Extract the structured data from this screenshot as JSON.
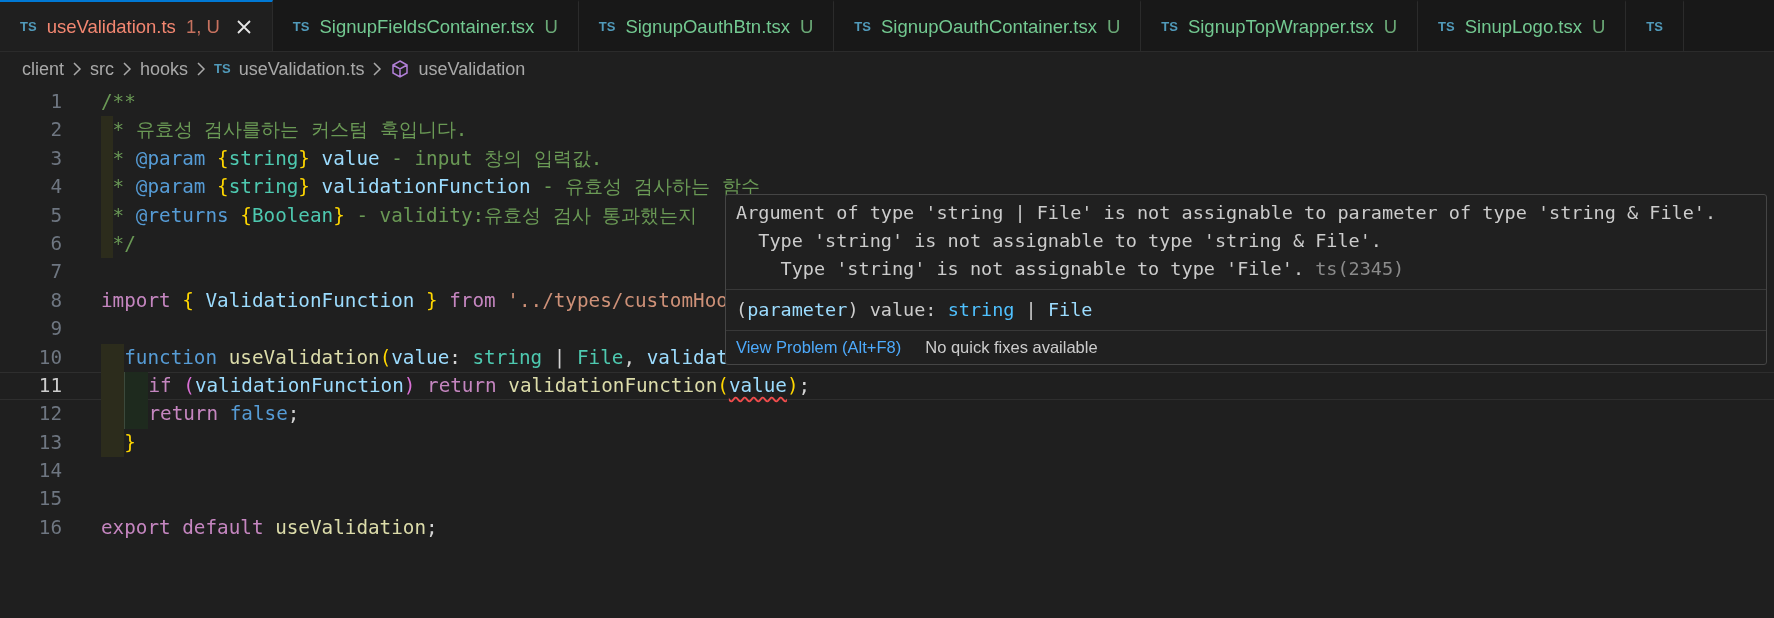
{
  "tabs": [
    {
      "icon": "TS",
      "label": "useValidation.ts",
      "badge": "1, U",
      "kind": "error",
      "selected": true
    },
    {
      "icon": "TS",
      "label": "SignupFieldsContainer.tsx",
      "badge": "U",
      "kind": "untracked",
      "selected": false
    },
    {
      "icon": "TS",
      "label": "SignupOauthBtn.tsx",
      "badge": "U",
      "kind": "untracked",
      "selected": false
    },
    {
      "icon": "TS",
      "label": "SignupOauthContainer.tsx",
      "badge": "U",
      "kind": "untracked",
      "selected": false
    },
    {
      "icon": "TS",
      "label": "SignupTopWrapper.tsx",
      "badge": "U",
      "kind": "untracked",
      "selected": false
    },
    {
      "icon": "TS",
      "label": "SinupLogo.tsx",
      "badge": "U",
      "kind": "untracked",
      "selected": false
    },
    {
      "icon": "TS",
      "selected": false
    }
  ],
  "breadcrumb": [
    {
      "kind": "folder",
      "label": "client"
    },
    {
      "kind": "folder",
      "label": "src"
    },
    {
      "kind": "folder",
      "label": "hooks"
    },
    {
      "kind": "file",
      "icon": "TS",
      "label": "useValidation.ts"
    },
    {
      "kind": "symbol",
      "label": "useValidation"
    }
  ],
  "lines": [
    {
      "number": "1",
      "current": false,
      "tokens": [
        {
          "kind": "comment",
          "text": "/**"
        }
      ]
    },
    {
      "number": "2",
      "current": false,
      "tokens": [
        {
          "kind": "comment",
          "text": " * 유효성 검사를하는 커스텀 훅입니다."
        }
      ]
    },
    {
      "number": "3",
      "current": false,
      "tokens": [
        {
          "kind": "comment",
          "text": " * "
        },
        {
          "kind": "tag",
          "text": "@param"
        },
        {
          "kind": "brace",
          "text": " {"
        },
        {
          "kind": "type",
          "text": "string"
        },
        {
          "kind": "brace",
          "text": "}"
        },
        {
          "kind": "variable",
          "text": " value"
        },
        {
          "kind": "comment",
          "text": " - input 창의 입력값."
        }
      ]
    },
    {
      "number": "4",
      "current": false,
      "tokens": [
        {
          "kind": "comment",
          "text": " * "
        },
        {
          "kind": "tag",
          "text": "@param"
        },
        {
          "kind": "brace",
          "text": " {"
        },
        {
          "kind": "type",
          "text": "string"
        },
        {
          "kind": "brace",
          "text": "}"
        },
        {
          "kind": "variable",
          "text": " validationFunction"
        },
        {
          "kind": "comment",
          "text": " - 유효성 검사하는 함수"
        }
      ]
    },
    {
      "number": "5",
      "current": false,
      "tokens": [
        {
          "kind": "comment",
          "text": " * "
        },
        {
          "kind": "tag",
          "text": "@returns"
        },
        {
          "kind": "brace",
          "text": " {"
        },
        {
          "kind": "type",
          "text": "Boolean"
        },
        {
          "kind": "brace",
          "text": "}"
        },
        {
          "kind": "comment",
          "text": " - validity:유효성 검사 통과했는지"
        }
      ]
    },
    {
      "number": "6",
      "current": false,
      "tokens": [
        {
          "kind": "comment",
          "text": " */"
        }
      ]
    },
    {
      "number": "7",
      "current": false
    },
    {
      "number": "8",
      "current": false,
      "tokens": [
        {
          "kind": "control",
          "text": "import"
        },
        {
          "kind": "brace",
          "text": " {"
        },
        {
          "kind": "variable",
          "text": " ValidationFunction"
        },
        {
          "kind": "brace",
          "text": " }"
        },
        {
          "kind": "control",
          "text": " from"
        },
        {
          "kind": "string",
          "text": " '../types/customHoo"
        }
      ]
    },
    {
      "number": "9",
      "current": false
    },
    {
      "number": "10",
      "current": false,
      "tokens": [
        {
          "kind": "storage",
          "text": "  function"
        },
        {
          "kind": "function",
          "text": " useValidation"
        },
        {
          "kind": "brace",
          "text": "("
        },
        {
          "kind": "variable",
          "text": "value"
        },
        {
          "kind": "plain",
          "text": ": "
        },
        {
          "kind": "type",
          "text": "string"
        },
        {
          "kind": "plain",
          "text": " | "
        },
        {
          "kind": "type",
          "text": "File"
        },
        {
          "kind": "plain",
          "text": ", "
        },
        {
          "kind": "variable",
          "text": "validat"
        }
      ]
    },
    {
      "number": "11",
      "current": true,
      "tokens": [
        {
          "kind": "control",
          "text": "    if"
        },
        {
          "kind": "brace2",
          "text": " ("
        },
        {
          "kind": "variable",
          "text": "validationFunction"
        },
        {
          "kind": "brace2",
          "text": ")"
        },
        {
          "kind": "control",
          "text": " return"
        },
        {
          "kind": "function",
          "text": " validationFunction"
        },
        {
          "kind": "brace",
          "text": "("
        },
        {
          "kind": "variable",
          "text": "value",
          "error": true
        },
        {
          "kind": "brace",
          "text": ")"
        },
        {
          "kind": "plain",
          "text": ";"
        }
      ]
    },
    {
      "number": "12",
      "current": false,
      "tokens": [
        {
          "kind": "control",
          "text": "    return"
        },
        {
          "kind": "storage",
          "text": " false"
        },
        {
          "kind": "plain",
          "text": ";"
        }
      ]
    },
    {
      "number": "13",
      "current": false,
      "tokens": [
        {
          "kind": "brace",
          "text": "  }"
        }
      ]
    },
    {
      "number": "14",
      "current": false
    },
    {
      "number": "15",
      "current": false
    },
    {
      "number": "16",
      "current": false,
      "tokens": [
        {
          "kind": "control",
          "text": "export"
        },
        {
          "kind": "control",
          "text": " default"
        },
        {
          "kind": "function",
          "text": " useValidation"
        },
        {
          "kind": "plain",
          "text": ";"
        }
      ]
    }
  ],
  "hover": {
    "messages": [
      {
        "text": "Argument of type 'string | File' is not assignable to parameter of type 'string & File'.",
        "children": [
          {
            "text": "Type 'string' is not assignable to type 'string & File'.",
            "children": [
              {
                "text": "Type 'string' is not assignable to type 'File'.",
                "code": "ts(2345)"
              }
            ]
          }
        ]
      }
    ],
    "signature": [
      {
        "kind": "plain",
        "text": "("
      },
      {
        "kind": "variable",
        "text": "parameter"
      },
      {
        "kind": "plain",
        "text": ") value: "
      },
      {
        "kind": "type",
        "text": "string"
      },
      {
        "kind": "plain",
        "text": " | "
      },
      {
        "kind": "variable",
        "text": "File"
      }
    ],
    "action": "View Problem (Alt+F8)",
    "note": "No quick fixes available"
  }
}
